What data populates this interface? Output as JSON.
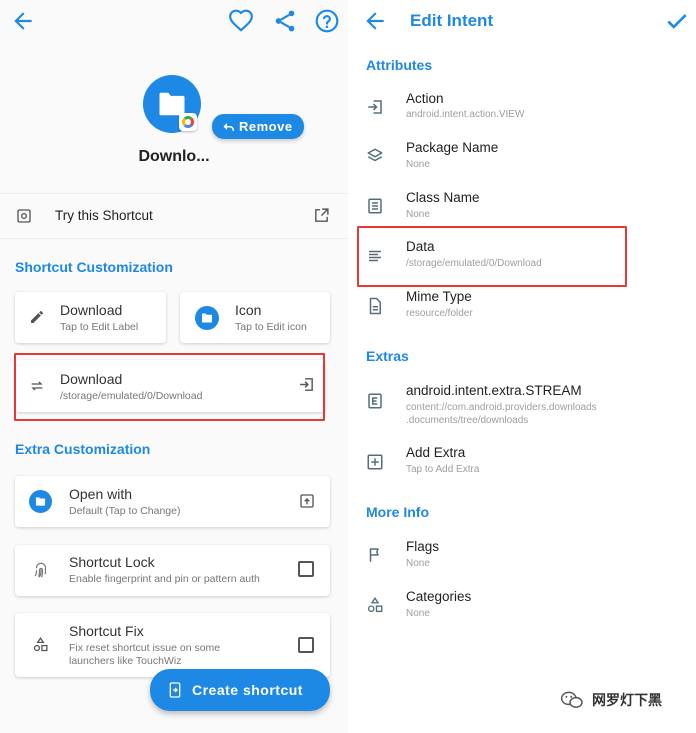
{
  "left": {
    "header": {
      "back_icon": "arrow-left-icon",
      "favorite_icon": "heart-icon",
      "share_icon": "share-icon",
      "help_icon": "help-circle-icon"
    },
    "shortcut_name": "Downlo...",
    "remove_label": "Remove",
    "try_label": "Try this Shortcut",
    "shortcut_customization": {
      "title": "Shortcut Customization",
      "label_card": {
        "title": "Download",
        "subtitle": "Tap to Edit Label"
      },
      "icon_card": {
        "title": "Icon",
        "subtitle": "Tap to Edit icon"
      },
      "target_card": {
        "title": "Download",
        "subtitle": "/storage/emulated/0/Download"
      }
    },
    "extra_customization": {
      "title": "Extra Customization",
      "items": [
        {
          "title": "Open with",
          "subtitle": "Default (Tap to Change)"
        },
        {
          "title": "Shortcut Lock",
          "subtitle": "Enable fingerprint and pin or pattern auth"
        },
        {
          "title": "Shortcut Fix",
          "subtitle": "Fix reset shortcut issue on some",
          "subtitle2": "launchers like TouchWiz"
        }
      ]
    },
    "create_label": "Create shortcut"
  },
  "right": {
    "header": {
      "title": "Edit Intent"
    },
    "attributes": {
      "title": "Attributes",
      "items": [
        {
          "title": "Action",
          "subtitle": "android.intent.action.VIEW"
        },
        {
          "title": "Package Name",
          "subtitle": "None"
        },
        {
          "title": "Class Name",
          "subtitle": "None"
        },
        {
          "title": "Data",
          "subtitle": "/storage/emulated/0/Download"
        },
        {
          "title": "Mime Type",
          "subtitle": "resource/folder"
        }
      ]
    },
    "extras": {
      "title": "Extras",
      "items": [
        {
          "title": "android.intent.extra.STREAM",
          "subtitle": "content://com.android.providers.downloads",
          "subtitle2": ".documents/tree/downloads"
        },
        {
          "title": "Add Extra",
          "subtitle": "Tap to Add Extra"
        }
      ]
    },
    "more_info": {
      "title": "More Info",
      "items": [
        {
          "title": "Flags",
          "subtitle": "None"
        },
        {
          "title": "Categories",
          "subtitle": "None"
        }
      ]
    }
  },
  "watermark": {
    "text": "网罗灯下黑"
  },
  "colors": {
    "accent": "#1e88e5",
    "highlight": "#e53935"
  }
}
